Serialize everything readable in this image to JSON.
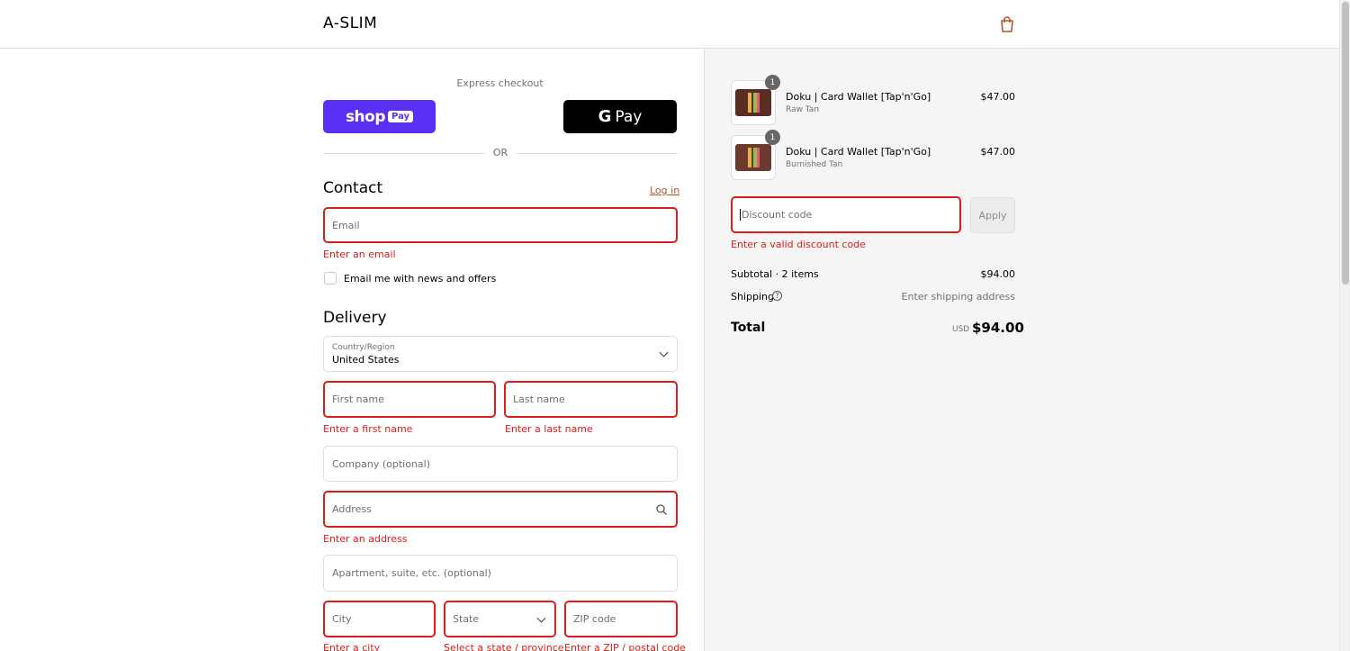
{
  "header": {
    "brand": "A-SLIM",
    "cart_icon": "shopping-bag-icon"
  },
  "express": {
    "label": "Express checkout",
    "shop_pay": {
      "shop": "shop",
      "pay": "Pay"
    },
    "google_pay": {
      "g": "G",
      "pay": "Pay"
    },
    "or": "OR"
  },
  "contact": {
    "title": "Contact",
    "login": "Log in",
    "email_placeholder": "Email",
    "email_error": "Enter an email",
    "newsletter_label": "Email me with news and offers"
  },
  "delivery": {
    "title": "Delivery",
    "country_label": "Country/Region",
    "country_value": "United States",
    "first_name": "First name",
    "first_name_error": "Enter a first name",
    "last_name": "Last name",
    "last_name_error": "Enter a last name",
    "company": "Company (optional)",
    "address": "Address",
    "address_error": "Enter an address",
    "apartment": "Apartment, suite, etc. (optional)",
    "city": "City",
    "city_error": "Enter a city",
    "state": "State",
    "state_error": "Select a state / province",
    "zip": "ZIP code",
    "zip_error": "Enter a ZIP / postal code"
  },
  "summary": {
    "items": [
      {
        "name": "Doku | Card Wallet [Tap'n'Go]",
        "variant": "Raw Tan",
        "price": "$47.00",
        "qty": "1",
        "color": "#5a2d22"
      },
      {
        "name": "Doku | Card Wallet [Tap'n'Go]",
        "variant": "Burnished Tan",
        "price": "$47.00",
        "qty": "1",
        "color": "#6b3a2e"
      }
    ],
    "discount_placeholder": "Discount code",
    "apply": "Apply",
    "discount_error": "Enter a valid discount code",
    "subtotal_label": "Subtotal · 2 items",
    "subtotal_value": "$94.00",
    "shipping_label": "Shipping",
    "shipping_value": "Enter shipping address",
    "total_label": "Total",
    "currency": "USD",
    "total_value": "$94.00"
  },
  "colors": {
    "error": "#dd1d1d",
    "shop_pay": "#5a31f4",
    "link": "#b9542e"
  }
}
